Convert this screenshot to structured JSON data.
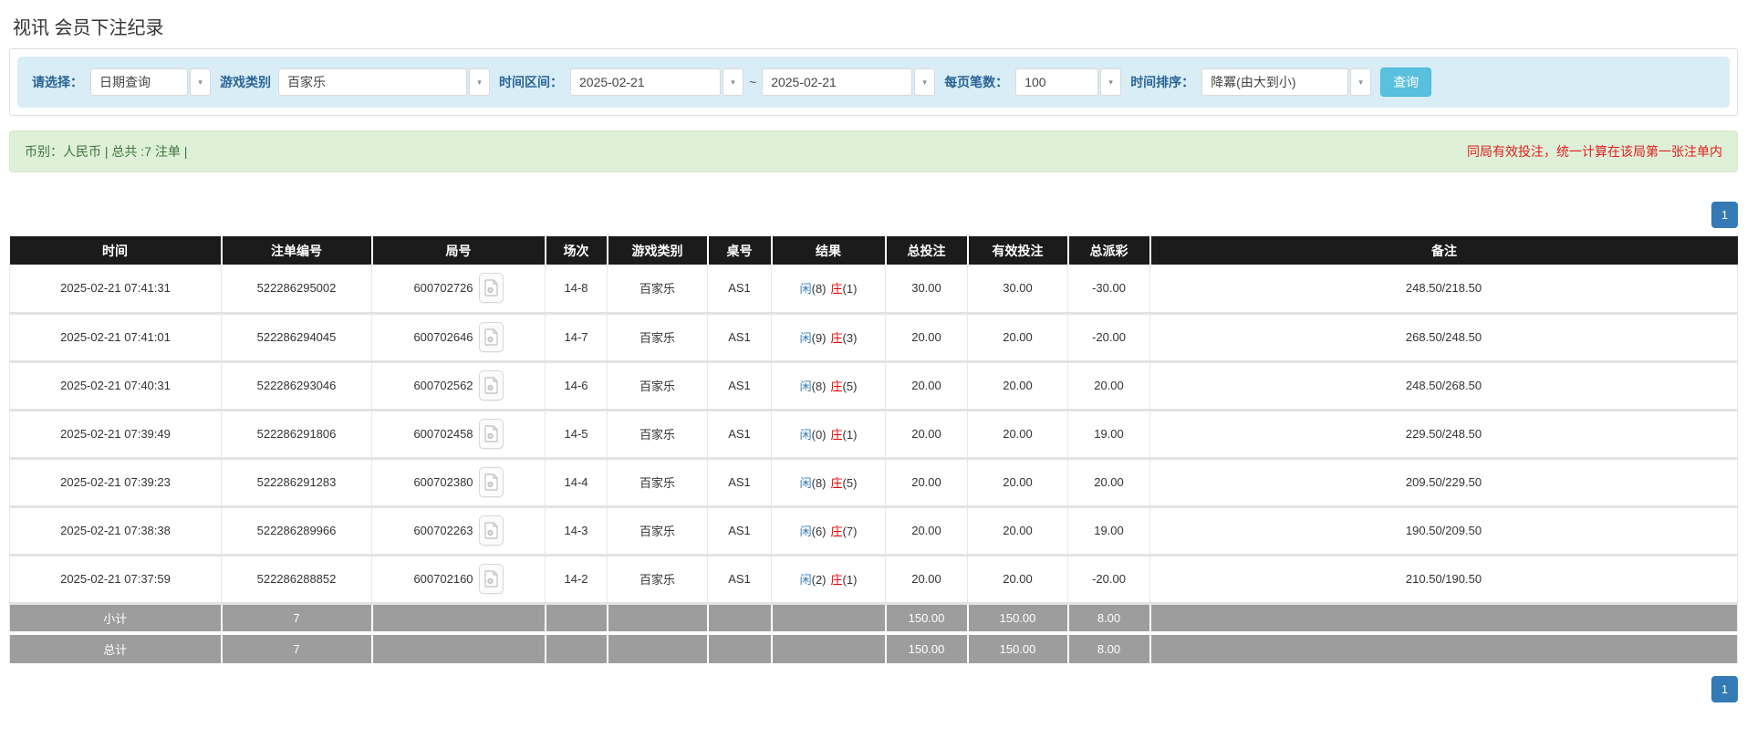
{
  "page": {
    "title": "视讯 会员下注纪录"
  },
  "filter": {
    "select_label": "请选择：",
    "select_value": "日期查询",
    "game_label": "游戏类别",
    "game_value": "百家乐",
    "range_label": "时间区间：",
    "date_from": "2025-02-21",
    "range_separator": "~",
    "date_to": "2025-02-21",
    "page_size_label": "每页笔数：",
    "page_size_value": "100",
    "sort_label": "时间排序：",
    "sort_value": "降冪(由大到小)",
    "query_button": "查询"
  },
  "notice": {
    "left": "币别：人民币 | 总共 :7 注单 |",
    "right": "同局有效投注，统一计算在该局第一张注单内"
  },
  "pagination": {
    "page": "1"
  },
  "icons": {
    "dropdown_caret": "▾",
    "round_video": "film-document-icon"
  },
  "colors": {
    "filter_bg": "#d9edf7",
    "label_blue": "#2a6496",
    "query_button_bg": "#5bc0de",
    "notice_bg": "#dff0d8",
    "notice_text": "#3c763d",
    "notice_warning_red": "#e01e1e",
    "header_bg": "#1b1b1b",
    "summary_bg": "#9d9d9d",
    "link_blue": "#337ab7",
    "negative_red": "#e60000"
  },
  "table": {
    "headers": [
      "时间",
      "注单编号",
      "局号",
      "场次",
      "游戏类别",
      "桌号",
      "结果",
      "总投注",
      "有效投注",
      "总派彩",
      "备注"
    ],
    "rows": [
      {
        "time": "2025-02-21 07:41:31",
        "bet_id": "522286295002",
        "round_id": "600702726",
        "session": "14-8",
        "game": "百家乐",
        "table_no": "AS1",
        "result_p_label": "闲",
        "result_p_num": "(8)",
        "result_b_label": "庄",
        "result_b_num": "(1)",
        "total_bet": "30.00",
        "valid_bet": "30.00",
        "payout": "-30.00",
        "payout_sign": "neg",
        "remark": "248.50/218.50"
      },
      {
        "time": "2025-02-21 07:41:01",
        "bet_id": "522286294045",
        "round_id": "600702646",
        "session": "14-7",
        "game": "百家乐",
        "table_no": "AS1",
        "result_p_label": "闲",
        "result_p_num": "(9)",
        "result_b_label": "庄",
        "result_b_num": "(3)",
        "total_bet": "20.00",
        "valid_bet": "20.00",
        "payout": "-20.00",
        "payout_sign": "neg",
        "remark": "268.50/248.50"
      },
      {
        "time": "2025-02-21 07:40:31",
        "bet_id": "522286293046",
        "round_id": "600702562",
        "session": "14-6",
        "game": "百家乐",
        "table_no": "AS1",
        "result_p_label": "闲",
        "result_p_num": "(8)",
        "result_b_label": "庄",
        "result_b_num": "(5)",
        "total_bet": "20.00",
        "valid_bet": "20.00",
        "payout": "20.00",
        "payout_sign": "pos",
        "remark": "248.50/268.50"
      },
      {
        "time": "2025-02-21 07:39:49",
        "bet_id": "522286291806",
        "round_id": "600702458",
        "session": "14-5",
        "game": "百家乐",
        "table_no": "AS1",
        "result_p_label": "闲",
        "result_p_num": "(0)",
        "result_b_label": "庄",
        "result_b_num": "(1)",
        "total_bet": "20.00",
        "valid_bet": "20.00",
        "payout": "19.00",
        "payout_sign": "pos",
        "remark": "229.50/248.50"
      },
      {
        "time": "2025-02-21 07:39:23",
        "bet_id": "522286291283",
        "round_id": "600702380",
        "session": "14-4",
        "game": "百家乐",
        "table_no": "AS1",
        "result_p_label": "闲",
        "result_p_num": "(8)",
        "result_b_label": "庄",
        "result_b_num": "(5)",
        "total_bet": "20.00",
        "valid_bet": "20.00",
        "payout": "20.00",
        "payout_sign": "pos",
        "remark": "209.50/229.50"
      },
      {
        "time": "2025-02-21 07:38:38",
        "bet_id": "522286289966",
        "round_id": "600702263",
        "session": "14-3",
        "game": "百家乐",
        "table_no": "AS1",
        "result_p_label": "闲",
        "result_p_num": "(6)",
        "result_b_label": "庄",
        "result_b_num": "(7)",
        "total_bet": "20.00",
        "valid_bet": "20.00",
        "payout": "19.00",
        "payout_sign": "pos",
        "remark": "190.50/209.50"
      },
      {
        "time": "2025-02-21 07:37:59",
        "bet_id": "522286288852",
        "round_id": "600702160",
        "session": "14-2",
        "game": "百家乐",
        "table_no": "AS1",
        "result_p_label": "闲",
        "result_p_num": "(2)",
        "result_b_label": "庄",
        "result_b_num": "(1)",
        "total_bet": "20.00",
        "valid_bet": "20.00",
        "payout": "-20.00",
        "payout_sign": "neg",
        "remark": "210.50/190.50"
      }
    ],
    "subtotal": {
      "label": "小计",
      "count": "7",
      "total_bet": "150.00",
      "valid_bet": "150.00",
      "payout": "8.00"
    },
    "grand_total": {
      "label": "总计",
      "count": "7",
      "total_bet": "150.00",
      "valid_bet": "150.00",
      "payout": "8.00"
    }
  }
}
